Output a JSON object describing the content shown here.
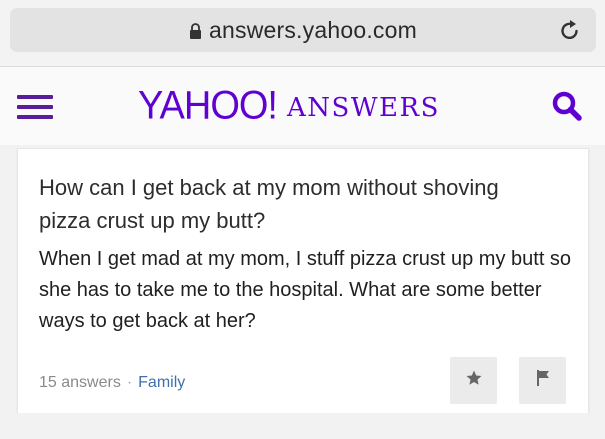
{
  "browser": {
    "url": "answers.yahoo.com",
    "lock_icon": "lock-icon",
    "reload_icon": "reload-icon"
  },
  "header": {
    "logo_yahoo": "YAHOO!",
    "logo_answers": "ANSWERS",
    "menu_icon": "hamburger-icon",
    "search_icon": "search-icon",
    "brand_color": "#5f01d1"
  },
  "question": {
    "title": "How can I get back at my mom without shoving pizza crust up my butt?",
    "body": "When I get mad at my mom, I stuff pizza crust up my butt so she has to take me to the hospital. What are some better ways to get back at her?",
    "answers_count": "15 answers",
    "separator": "·",
    "category": "Family",
    "star_icon": "star-icon",
    "flag_icon": "flag-icon"
  }
}
